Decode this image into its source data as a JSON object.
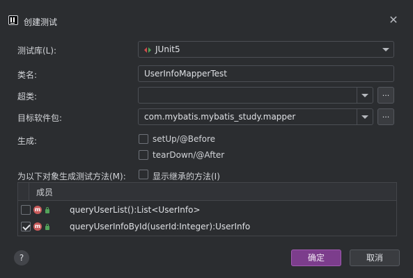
{
  "window": {
    "title": "创建测试",
    "close_symbol": "✕"
  },
  "form": {
    "library_label": "测试库(L):",
    "library_value": "JUnit5",
    "class_label": "类名:",
    "class_value": "UserInfoMapperTest",
    "superclass_label": "超类:",
    "superclass_value": "",
    "package_label": "目标软件包:",
    "package_value": "com.mybatis.mybatis_study.mapper",
    "browse_label": "...",
    "generate_label": "生成:",
    "setup_label": "setUp/@Before",
    "setup_checked": false,
    "teardown_label": "tearDown/@After",
    "teardown_checked": false,
    "methods_label": "为以下对象生成测试方法(M):",
    "inherited_label": "显示继承的方法(I)",
    "inherited_checked": false
  },
  "table": {
    "header": "成员",
    "rows": [
      {
        "text": "queryUserList():List<UserInfo>",
        "checked": false,
        "icon": "method-icon"
      },
      {
        "text": "queryUserInfoById(userId:Integer):UserInfo",
        "checked": true,
        "icon": "method-icon"
      }
    ]
  },
  "footer": {
    "help_symbol": "?",
    "ok_label": "确定",
    "cancel_label": "取消"
  },
  "colors": {
    "background": "#2b2d30",
    "accent": "#7c3d8c",
    "method_icon": "#c95a5a",
    "visibility_icon": "#53a35a"
  }
}
